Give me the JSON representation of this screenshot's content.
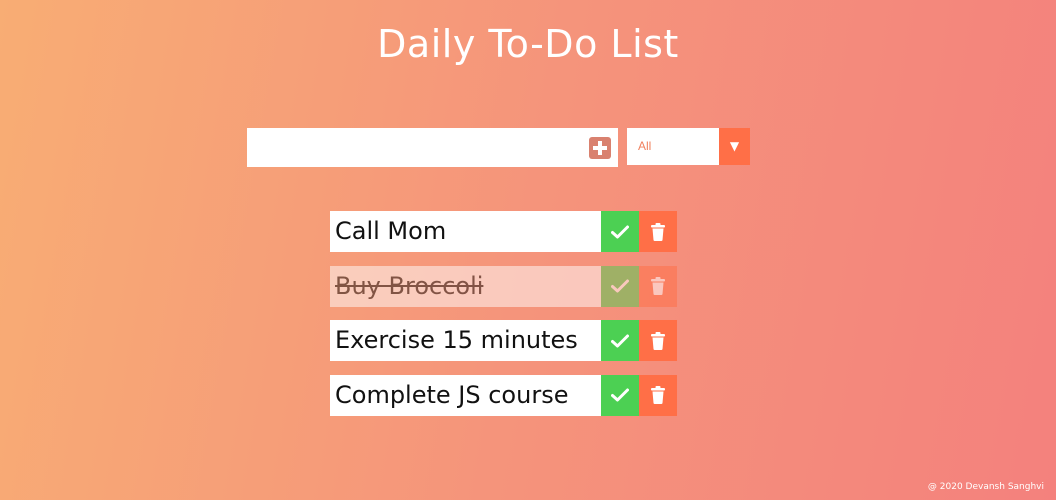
{
  "header": {
    "title": "Daily To-Do List"
  },
  "form": {
    "input_value": "",
    "filter_selected": "All",
    "filter_arrow": "▼"
  },
  "todos": [
    {
      "text": "Call Mom",
      "completed": false
    },
    {
      "text": "Buy Broccoli",
      "completed": true
    },
    {
      "text": "Exercise 15 minutes",
      "completed": false
    },
    {
      "text": "Complete JS course",
      "completed": false
    }
  ],
  "icons": {
    "add": "plus-square-icon",
    "complete": "check-icon",
    "delete": "trash-icon"
  },
  "colors": {
    "gradient_start": "#f8ad74",
    "gradient_end": "#f4817d",
    "check_green": "#4cd053",
    "trash_orange": "#ff6f47",
    "add_button": "#d9816f",
    "filter_text": "#f0805e"
  },
  "footer": {
    "credit": "@ 2020 Devansh Sanghvi"
  }
}
